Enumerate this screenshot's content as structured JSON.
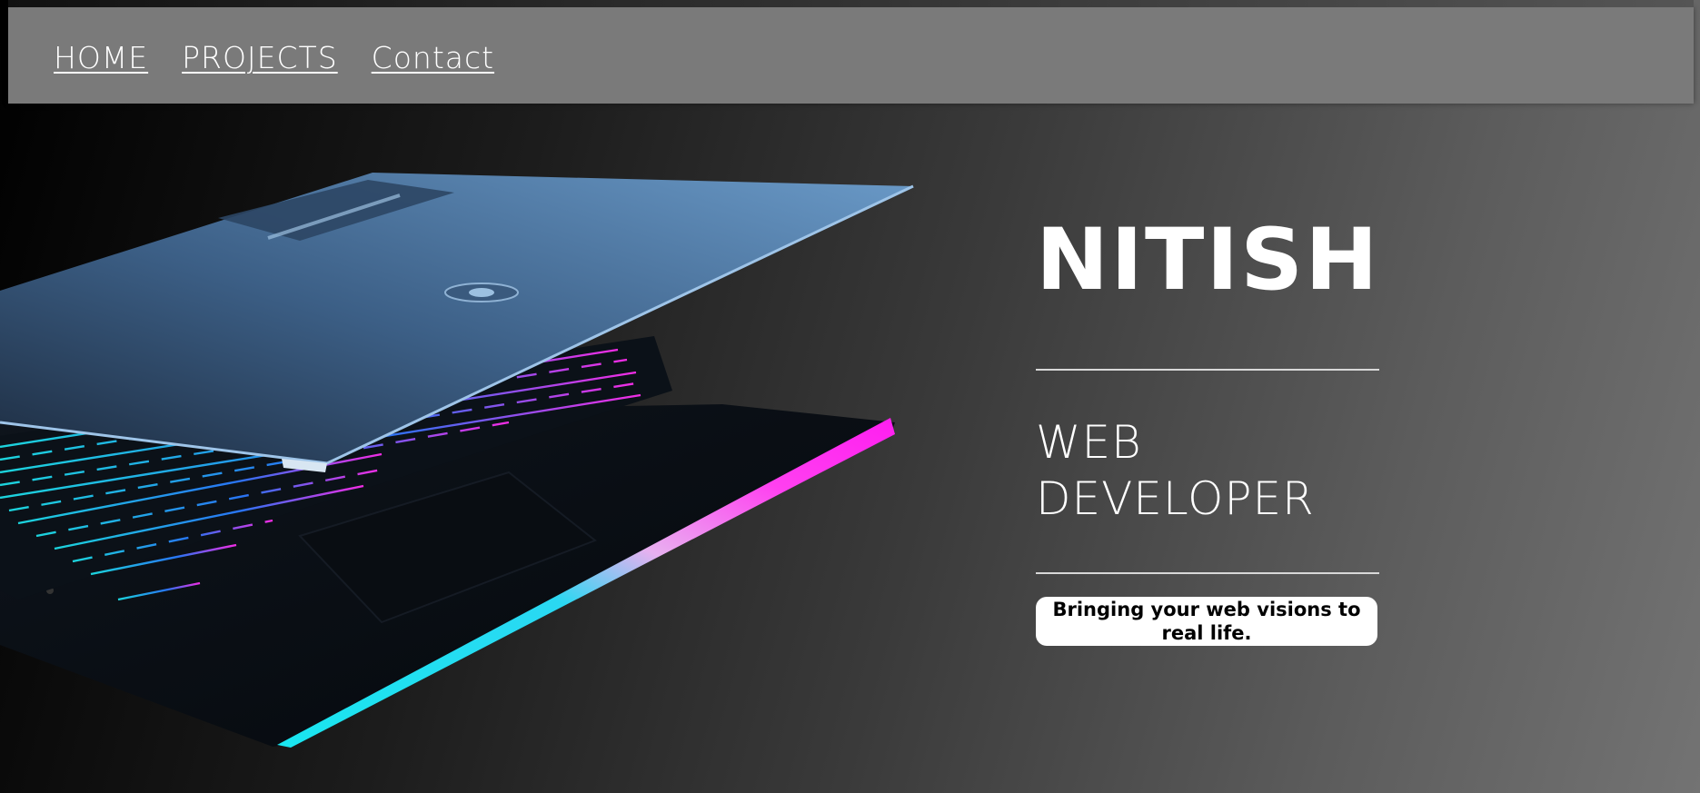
{
  "nav": {
    "links": [
      {
        "label": "HOME"
      },
      {
        "label": "PROJECTS"
      },
      {
        "label": "Contact"
      }
    ]
  },
  "hero": {
    "name": "NITISH",
    "role_line1": "WEB",
    "role_line2": "DEVELOPER",
    "tagline": "Bringing your web visions to real life."
  },
  "image": {
    "subject": "laptop-icon"
  },
  "colors": {
    "nav_bg": "#7a7a7a",
    "text": "#ffffff",
    "accent_cyan": "#19e6f0",
    "accent_magenta": "#ff1ef0",
    "laptop_lid": "#5a8cc0"
  }
}
